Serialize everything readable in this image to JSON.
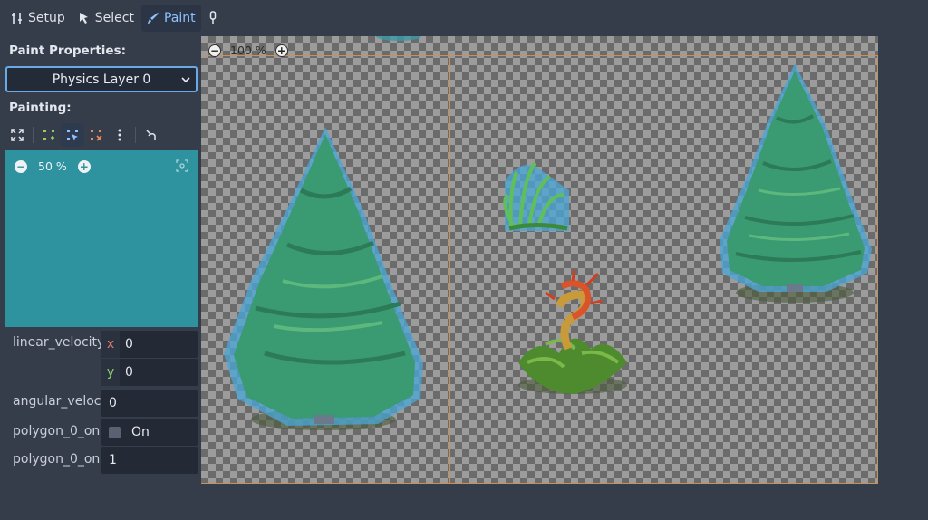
{
  "toolbar": {
    "setup_label": "Setup",
    "select_label": "Select",
    "paint_label": "Paint"
  },
  "left": {
    "paint_properties_label": "Paint Properties:",
    "layer_select_value": "Physics Layer 0",
    "painting_label": "Painting:",
    "preview_zoom": "50 %"
  },
  "properties": {
    "linear_velocity_label": "linear_velocity",
    "linear_velocity_x": "0",
    "linear_velocity_y": "0",
    "x_axis": "x",
    "y_axis": "y",
    "angular_velocity_label": "angular_veloci",
    "angular_velocity_value": "0",
    "polygon_0_one_way_label": "polygon_0_on",
    "polygon_0_one_way_value": "On",
    "polygon_0_one_way_margin_label": "polygon_0_on",
    "polygon_0_one_way_margin_value": "1"
  },
  "viewport": {
    "zoom": "100 %"
  },
  "colors": {
    "accent": "#8ec3ff",
    "preview_bg": "#2e939f",
    "panel_bg": "#363d4a",
    "atlas_border": "#c9905c",
    "collision": "#4aa7d8"
  },
  "icons": [
    "tool-setup-icon",
    "select-arrow-icon",
    "paint-brush-icon",
    "pin-icon",
    "zoom-out-icon",
    "zoom-in-icon",
    "center-view-icon",
    "fullscreen-icon",
    "add-points-icon",
    "edit-points-icon",
    "delete-points-icon",
    "more-icon",
    "flip-icon"
  ]
}
